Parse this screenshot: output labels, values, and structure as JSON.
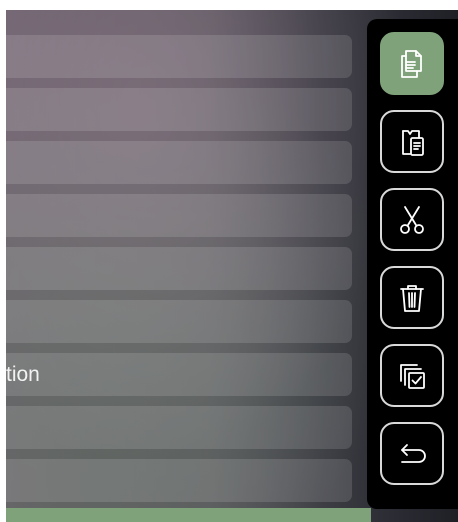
{
  "list": {
    "rows": [
      {
        "label": ""
      },
      {
        "label": ""
      },
      {
        "label": ""
      },
      {
        "label": ""
      },
      {
        "label": ""
      },
      {
        "label": ""
      },
      {
        "label": "tion"
      },
      {
        "label": ""
      },
      {
        "label": ""
      }
    ]
  },
  "toolbar": {
    "buttons": [
      {
        "name": "copy",
        "icon": "copy-icon",
        "active": true
      },
      {
        "name": "paste",
        "icon": "paste-icon",
        "active": false
      },
      {
        "name": "cut",
        "icon": "scissors-icon",
        "active": false
      },
      {
        "name": "delete",
        "icon": "trash-icon",
        "active": false
      },
      {
        "name": "select-all",
        "icon": "multi-select-icon",
        "active": false
      },
      {
        "name": "back",
        "icon": "return-icon",
        "active": false
      }
    ]
  },
  "colors": {
    "accent": "#7fa27a",
    "panel_bg": "#000000",
    "icon_stroke": "#ffffff"
  }
}
